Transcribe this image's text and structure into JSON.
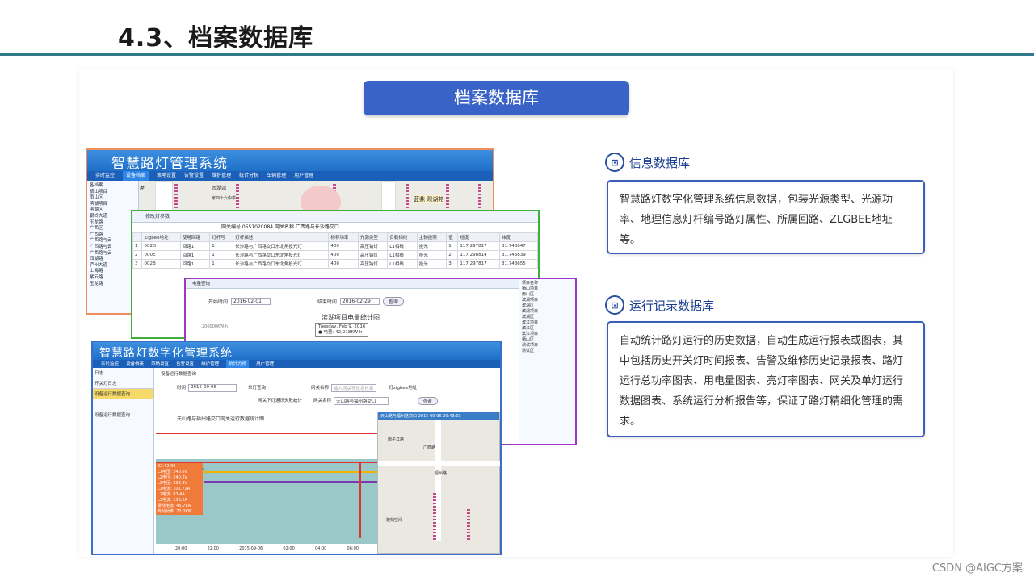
{
  "slide": {
    "title": "4.3、档案数据库",
    "banner": "档案数据库",
    "watermark": "CSDN @AIGC方案"
  },
  "sections": [
    {
      "title": "信息数据库",
      "icon": "document-chart-icon",
      "text": "智慧路灯数字化管理系统信息数据，包装光源类型、光源功率、地理信息灯杆编号路灯属性、所属回路、ZLGBEE地址等。"
    },
    {
      "title": "运行记录数据库",
      "icon": "document-chart-icon",
      "text": "自动统计路灯运行的历史数据，自动生成运行报表或图表，其中包括历史开关灯时间报表、告警及维修历史记录报表、路灯运行总功率图表、用电量图表、亮灯率图表、网关及单灯运行数据图表、系统运行分析报告等，保证了路灯精细化管理的需求。"
    }
  ],
  "app_main": {
    "title": "智慧路灯管理系统",
    "menu": [
      "实时监控",
      "设备档案",
      "策略设置",
      "告警设置",
      "维护管理",
      "统计分析",
      "车辆管理",
      "用户管理"
    ],
    "active_menu": "设备档案",
    "tree": [
      "各档案",
      "栖山项目",
      "雨山区",
      "滨湖项目",
      "滨湖区",
      "银岭大道",
      "玉龙路",
      "广西区",
      "广西路",
      "广西路与云",
      "广西路与云",
      "广西路与云",
      "西湖路",
      "庐州大道",
      "上海路",
      "紫云路",
      "玉龙路"
    ],
    "map_labels": [
      "屋",
      "西湖站",
      "家四十六中学",
      "蓝鼎·观湖苑"
    ]
  },
  "app_config": {
    "title": "修改灯参数",
    "gateway": "网关编号 0551020084   网关名称 广西路与长沙路交口",
    "columns": [
      "",
      "Zigbee地址",
      "使用回路",
      "灯杆号",
      "灯杆描述",
      "标称功率",
      "光源类型",
      "负载相线",
      "主辅投照",
      "值",
      "经度",
      "纬度"
    ],
    "rows": [
      [
        "1",
        "002D",
        "回路1",
        "1",
        "长沙路与广西路交口东北角投光灯",
        "400",
        "高压钠灯",
        "L1相线",
        "投光",
        "1",
        "117.297817",
        "31.743847"
      ],
      [
        "2",
        "000E",
        "回路1",
        "1",
        "长沙路与广西路交口东北角投光灯",
        "400",
        "高压钠灯",
        "L1相线",
        "投光",
        "2",
        "117.298814",
        "31.743839"
      ],
      [
        "3",
        "002B",
        "回路1",
        "1",
        "长沙路与广西路交口东北角投光灯",
        "400",
        "高压钠灯",
        "L1相线",
        "投光",
        "3",
        "117.297817",
        "31.743655"
      ]
    ]
  },
  "app_energy": {
    "tab": "电量查询",
    "start_label": "开始时间",
    "start": "2016-02-01",
    "end_label": "结束时间",
    "end": "2016-02-29",
    "query": "查询",
    "chart_title": "滨湖项目电量统计图",
    "tooltip_date": "Tuesday, Feb 9, 2016",
    "tooltip_value": "● 电量: 42,218KW·h",
    "y_label": "200000KW·h",
    "tree": [
      "项目名称",
      "栖山项目",
      "雨山区",
      "滨湖项目",
      "滨湖区",
      "滨湖项目",
      "滨湖区",
      "滨江项目",
      "滨江区",
      "滨江项目",
      "栖山区",
      "测试项目",
      "测试区"
    ],
    "row_nums": [
      "4",
      "5",
      "6",
      "7",
      "8",
      "9"
    ]
  },
  "app_run": {
    "title": "智慧路灯数字化管理系统",
    "menu": [
      "实时监控",
      "设备档案",
      "策略设置",
      "告警设置",
      "维护管理",
      "统计分析",
      "用户管理"
    ],
    "active_menu": "统计分析",
    "side_head": "日志",
    "side_items": [
      "开关灯日志",
      "设备运行数据查询"
    ],
    "tab": "设备运行数据查询",
    "date_label": "时间",
    "date": "2015-09-06",
    "gateway_label": "网关名称",
    "gateway_ph": "输入网关等信息检索",
    "single_label": "单灯查询",
    "zigbee_label": "灯zigbee地址",
    "check2": "网关下灯通讯失败统计",
    "gateway2_label": "网关名称",
    "gateway2": "天山路与福州路交口",
    "query": "查询",
    "chart_title": "天山路与福州路交口网关运行数据统计图",
    "legend_time": "22:42:00",
    "legend": [
      "L1电压: 240.6V",
      "L2电压: 240.2V",
      "L3电压: 238.8V",
      "L1电流: 101.72A",
      "L2电流: 83.4A",
      "L3电流: 138.2A",
      "零线电流: 45.78A",
      "有功功率: 72.0KW"
    ],
    "x_ticks": [
      "20:00",
      "22:00",
      "2015-09-06",
      "02:00",
      "04:00",
      "06:00"
    ],
    "map_head": "天山路与福州路交口 2015-09-06 20:43:03",
    "map_labels": [
      "南子江路",
      "广西路",
      "万宴天路",
      "福州路",
      "东冠道",
      "融科园",
      "元旦东",
      "万宴大路",
      "雕刻空间"
    ],
    "side_icon_label": "设备运行数据查询"
  },
  "colors": {
    "accent": "#3a63c8",
    "rule": "#2f7a86",
    "orange": "#f08d5c",
    "green": "#3fae3a",
    "purple": "#9a3ac2"
  }
}
